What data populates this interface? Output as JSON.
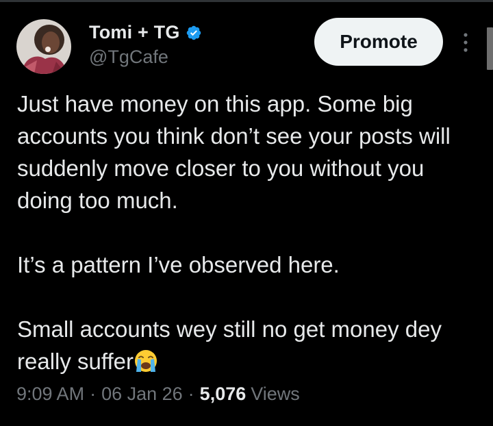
{
  "tweet": {
    "author": {
      "display_name": "Tomi + TG",
      "handle": "@TgCafe",
      "verified": true
    },
    "promote_label": "Promote",
    "paragraphs": [
      "Just have money on this app. Some big accounts you think don’t see your posts will suddenly move closer to you without you doing too much.",
      "It’s a pattern I’ve observed here.",
      "Small accounts wey still no get money dey really suffer"
    ],
    "emoji": "crying-face-emoji",
    "time": "9:09 AM",
    "date": "06 Jan 26",
    "separator": "·",
    "views_count": "5,076",
    "views_label": "Views"
  },
  "colors": {
    "background": "#000000",
    "primary_text": "#e7e9ea",
    "secondary_text": "#71767b",
    "verified_blue": "#1d9bf0",
    "button_bg": "#eff3f4"
  }
}
